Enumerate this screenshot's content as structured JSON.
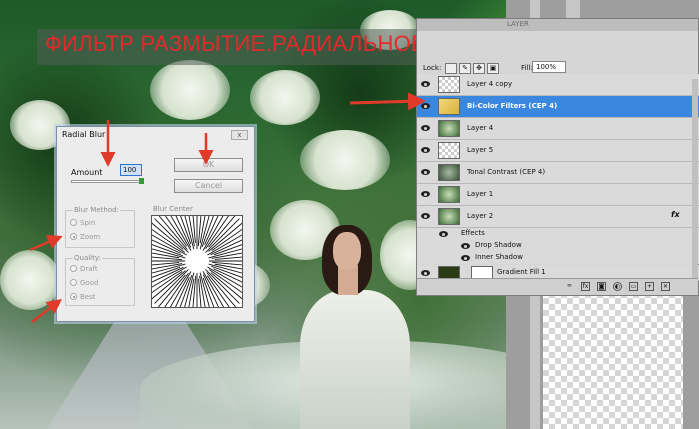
{
  "banner": {
    "text": "ФИЛЬТР РАЗМЫТИЕ.РАДИАЛЬНОЕ РАЗМЫТИЕ."
  },
  "layers_panel": {
    "tab_label": "LAYER",
    "lock_label": "Lock:",
    "fill_label": "Fill:",
    "fill_value": "100%",
    "layers": [
      {
        "name": "Layer 4 copy",
        "selected": false
      },
      {
        "name": "Bi-Color Filters (CEP 4)",
        "selected": true
      },
      {
        "name": "Layer 4",
        "selected": false
      },
      {
        "name": "Layer 5",
        "selected": false
      },
      {
        "name": "Tonal Contrast (CEP 4)",
        "selected": false
      },
      {
        "name": "Layer 1",
        "selected": false
      },
      {
        "name": "Layer 2",
        "selected": false,
        "fx": "fx"
      }
    ],
    "effects_label": "Effects",
    "effects": [
      "Drop Shadow",
      "Inner Shadow"
    ],
    "gradient_layer": "Gradient Fill 1"
  },
  "dialog": {
    "title": "Radial Blur",
    "close_label": "x",
    "ok_label": "OK",
    "cancel_label": "Cancel",
    "amount_label": "Amount",
    "amount_value": "100",
    "amount_fraction": 1.0,
    "blur_method_label": "Blur Method:",
    "blur_method_options": [
      "Spin",
      "Zoom"
    ],
    "blur_method_selected": "Zoom",
    "quality_label": "Quality:",
    "quality_options": [
      "Draft",
      "Good",
      "Best"
    ],
    "quality_selected": "Best",
    "blur_center_label": "Blur Center"
  },
  "colors": {
    "banner_text": "#e5282a",
    "selection": "#3a87e0",
    "arrow": "#e03a2a"
  }
}
